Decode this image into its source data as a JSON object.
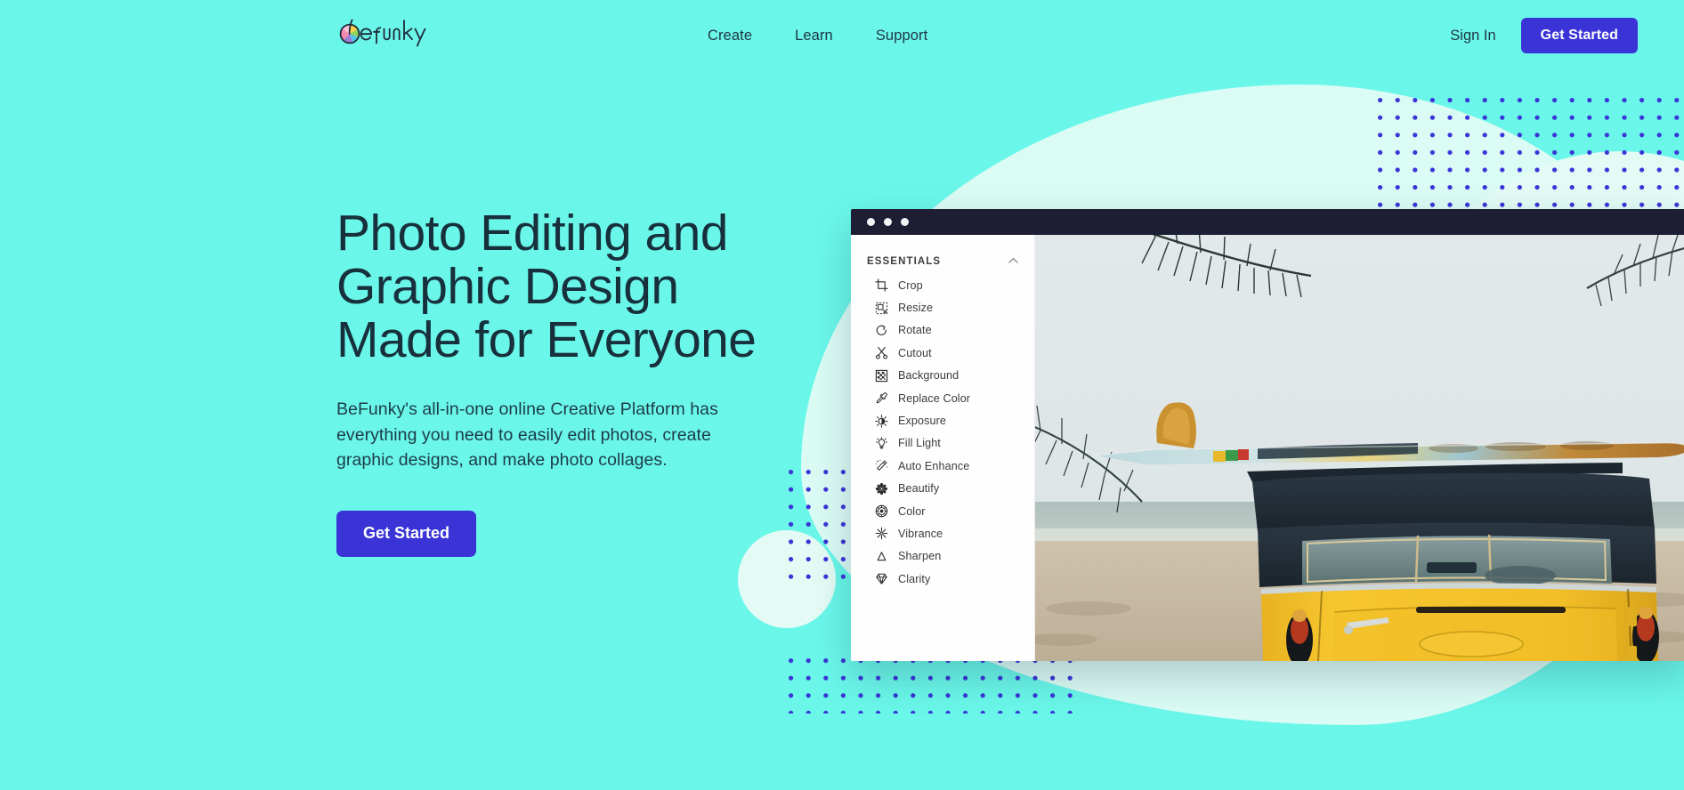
{
  "brand": {
    "name": "befunky",
    "logo_icon": "aperture-color-wheel-icon",
    "colors": {
      "page_background": "#6af7ea",
      "accent": "#3a33d6",
      "heading": "#17303b",
      "dot_pattern": "#3a33d6",
      "blob": "#e2fbf5",
      "titlebar": "#1d1d33"
    }
  },
  "header": {
    "nav": [
      {
        "label": "Create",
        "name": "nav-create"
      },
      {
        "label": "Learn",
        "name": "nav-learn"
      },
      {
        "label": "Support",
        "name": "nav-support"
      }
    ],
    "sign_in_label": "Sign In",
    "get_started_label": "Get Started"
  },
  "hero": {
    "headline_lines": [
      "Photo Editing and",
      "Graphic Design",
      "Made for Everyone"
    ],
    "headline": "Photo Editing and Graphic Design Made for Everyone",
    "paragraph": "BeFunky's all-in-one online Creative Platform has everything you need to easily edit photos, create graphic designs, and make photo collages.",
    "cta_label": "Get Started"
  },
  "editor_window": {
    "titlebar_dots": 3,
    "panel": {
      "section_title": "ESSENTIALS",
      "collapse_icon": "chevron-up-icon",
      "tools": [
        {
          "label": "Crop",
          "icon": "crop-icon"
        },
        {
          "label": "Resize",
          "icon": "resize-icon"
        },
        {
          "label": "Rotate",
          "icon": "rotate-icon"
        },
        {
          "label": "Cutout",
          "icon": "scissors-icon"
        },
        {
          "label": "Background",
          "icon": "checkerboard-icon"
        },
        {
          "label": "Replace Color",
          "icon": "eyedropper-icon"
        },
        {
          "label": "Exposure",
          "icon": "exposure-icon"
        },
        {
          "label": "Fill Light",
          "icon": "lightbulb-icon"
        },
        {
          "label": "Auto Enhance",
          "icon": "magic-wand-icon"
        },
        {
          "label": "Beautify",
          "icon": "flower-icon"
        },
        {
          "label": "Color",
          "icon": "color-wheel-icon"
        },
        {
          "label": "Vibrance",
          "icon": "sparkle-icon"
        },
        {
          "label": "Sharpen",
          "icon": "triangle-icon"
        },
        {
          "label": "Clarity",
          "icon": "diamond-icon"
        }
      ]
    },
    "canvas": {
      "photo_description": "Yellow vintage VW van parked on a sandy beach with a surfboard on the roof rack, palm fronds overhead and the ocean behind"
    }
  }
}
